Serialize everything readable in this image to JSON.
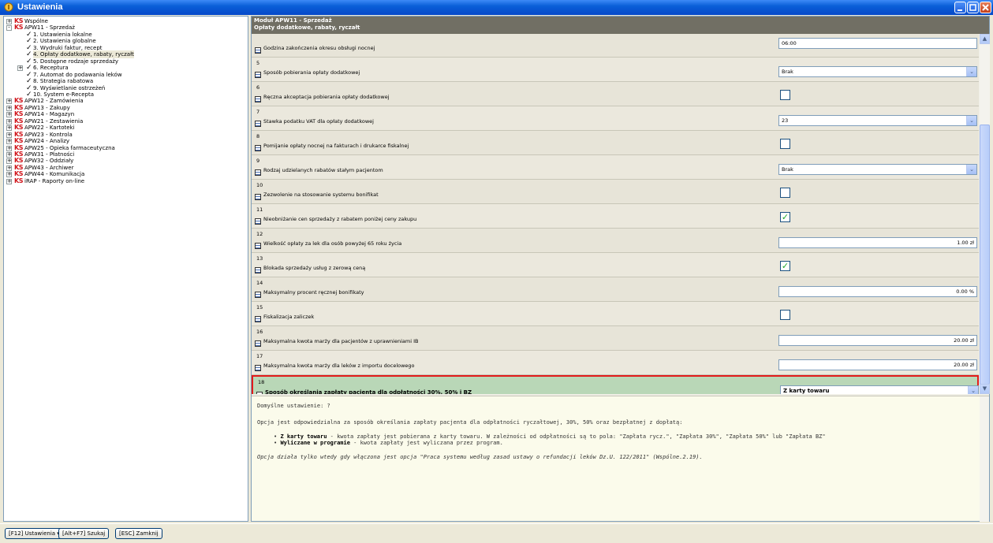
{
  "window": {
    "title": "Ustawienia"
  },
  "tree": [
    {
      "label": "Wspólne",
      "level": 0,
      "exp": "+",
      "ks": true
    },
    {
      "label": "APW11 - Sprzedaż",
      "level": 0,
      "exp": "-",
      "ks": true
    },
    {
      "label": "1. Ustawienia lokalne",
      "level": 1,
      "chk": true
    },
    {
      "label": "2. Ustawienia globalne",
      "level": 1,
      "chk": true
    },
    {
      "label": "3. Wydruki faktur, recept",
      "level": 1,
      "chk": true
    },
    {
      "label": "4. Opłaty dodatkowe, rabaty, ryczałt",
      "level": 1,
      "chk": true,
      "selected": true
    },
    {
      "label": "5. Dostępne rodzaje sprzedaży",
      "level": 1,
      "chk": true
    },
    {
      "label": "6. Receptura",
      "level": 1,
      "chk": true,
      "exp": "+"
    },
    {
      "label": "7. Automat do podawania leków",
      "level": 1,
      "chk": true
    },
    {
      "label": "8. Strategia rabatowa",
      "level": 1,
      "chk": true
    },
    {
      "label": "9. Wyświetlanie ostrzeżeń",
      "level": 1,
      "chk": true
    },
    {
      "label": "10. System e-Recepta",
      "level": 1,
      "chk": true
    },
    {
      "label": "APW12 - Zamówienia",
      "level": 0,
      "exp": "+",
      "ks": true
    },
    {
      "label": "APW13 - Zakupy",
      "level": 0,
      "exp": "+",
      "ks": true
    },
    {
      "label": "APW14 - Magazyn",
      "level": 0,
      "exp": "+",
      "ks": true
    },
    {
      "label": "APW21 - Zestawienia",
      "level": 0,
      "exp": "+",
      "ks": true
    },
    {
      "label": "APW22 - Kartoteki",
      "level": 0,
      "exp": "+",
      "ks": true
    },
    {
      "label": "APW23 - Kontrola",
      "level": 0,
      "exp": "+",
      "ks": true
    },
    {
      "label": "APW24 - Analizy",
      "level": 0,
      "exp": "+",
      "ks": true
    },
    {
      "label": "APW25 - Opieka farmaceutyczna",
      "level": 0,
      "exp": "+",
      "ks": true
    },
    {
      "label": "APW31 - Płatności",
      "level": 0,
      "exp": "+",
      "ks": true
    },
    {
      "label": "APW32 - Oddziały",
      "level": 0,
      "exp": "+",
      "ks": true
    },
    {
      "label": "APW43 - Archiwer",
      "level": 0,
      "exp": "+",
      "ks": true
    },
    {
      "label": "APW44 - Komunikacja",
      "level": 0,
      "exp": "+",
      "ks": true
    },
    {
      "label": "iRAP - Raporty on-line",
      "level": 0,
      "exp": "+",
      "ks": true
    }
  ],
  "panel": {
    "title": "Moduł APW11 - Sprzedaż",
    "subtitle": "Opłaty dodatkowe, rabaty, ryczałt"
  },
  "rows": [
    {
      "num": "",
      "label": "Godzina zakończenia okresu obsługi nocnej",
      "type": "text",
      "value": "06:00",
      "align": "left"
    },
    {
      "num": "5",
      "label": "Sposób pobierania opłaty dodatkowej",
      "type": "select",
      "value": "Brak"
    },
    {
      "num": "6",
      "label": "Ręczna akceptacja pobierania opłaty dodatkowej",
      "type": "check",
      "checked": false
    },
    {
      "num": "7",
      "label": "Stawka podatku VAT dla opłaty dodatkowej",
      "type": "select",
      "value": "23"
    },
    {
      "num": "8",
      "label": "Pomijanie opłaty nocnej na fakturach i drukarce fiskalnej",
      "type": "check",
      "checked": false
    },
    {
      "num": "9",
      "label": "Rodzaj udzielanych rabatów stałym pacjentom",
      "type": "select",
      "value": "Brak"
    },
    {
      "num": "10",
      "label": "Zezwolenie na stosowanie systemu bonifikat",
      "type": "check",
      "checked": false
    },
    {
      "num": "11",
      "label": "Nieobniżanie cen sprzedaży z rabatem poniżej ceny zakupu",
      "type": "check",
      "checked": true
    },
    {
      "num": "12",
      "label": "Wielkość opłaty za lek dla osób powyżej 65 roku życia",
      "type": "text",
      "value": "1.00 zł",
      "align": "right"
    },
    {
      "num": "13",
      "label": "Blokada sprzedaży usług z zerową ceną",
      "type": "check",
      "checked": true
    },
    {
      "num": "14",
      "label": "Maksymalny procent ręcznej bonifikaty",
      "type": "text",
      "value": "0.00 %",
      "align": "right"
    },
    {
      "num": "15",
      "label": "Fiskalizacja zaliczek",
      "type": "check",
      "checked": false
    },
    {
      "num": "16",
      "label": "Maksymalna kwota marży dla pacjentów z uprawnieniami IB",
      "type": "text",
      "value": "20.00 zł",
      "align": "right"
    },
    {
      "num": "17",
      "label": "Maksymalna kwota marży dla leków z importu docelowego",
      "type": "text",
      "value": "20.00 zł",
      "align": "right"
    },
    {
      "num": "18",
      "label": "Sposób określania zapłaty pacjenta dla odpłatności 30%, 50% i BZ",
      "type": "select",
      "value": "Z karty towaru",
      "highlight": true
    }
  ],
  "dropdown": {
    "options": [
      "Wyliczane w programie",
      "Z karty towaru"
    ],
    "selected": "Z karty towaru"
  },
  "desc": {
    "default": "Domyślne ustawienie: ?",
    "intro": "Opcja jest odpowiedzialna za sposób określania zapłaty pacjenta dla odpłatności ryczałtowej, 30%, 50% oraz bezpłatnej z dopłatą:",
    "items": [
      {
        "bold": "Z karty towaru",
        "text": " - kwota zapłaty jest pobierana z karty towaru. W zależności od odpłatności są to pola: \"Zapłata rycz.\", \"Zapłata 30%\", \"Zapłata 50%\" lub \"Zapłata BZ\""
      },
      {
        "bold": "Wyliczane w programie",
        "text": " - kwota zapłaty jest wyliczana przez program."
      }
    ],
    "note": "Opcja działa tylko wtedy gdy włączona jest opcja \"Praca systemu według zasad ustawy o refundacji leków Dz.U. 122/2011\" (Wspólne.2.19)."
  },
  "bottom": {
    "b1": "[F12] Ustawienia ▾",
    "b2": "[Alt+F7] Szukaj",
    "b3": "[ESC] Zamknij"
  },
  "icons": {
    "expand": "plus-box-icon",
    "check": "checkmark-icon",
    "module": "ks-logo-icon",
    "option": "option-doc-icon"
  }
}
